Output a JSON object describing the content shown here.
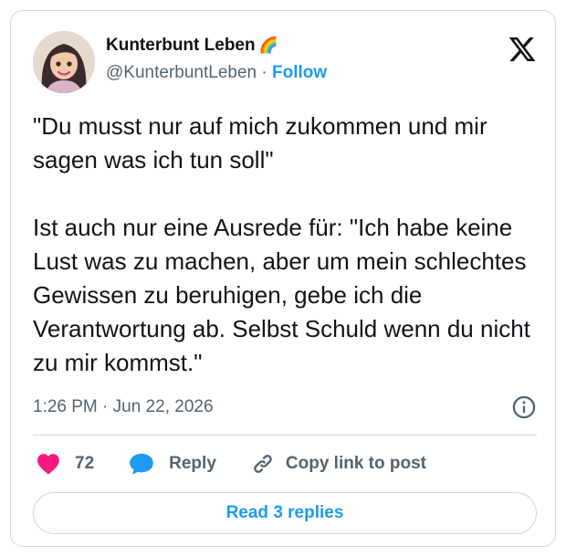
{
  "author": {
    "name": "Kunterbunt Leben",
    "name_emoji": "🌈",
    "handle": "@KunterbuntLeben",
    "separator": " · ",
    "follow_label": "Follow"
  },
  "tweet": {
    "text": "\"Du musst nur auf mich zukommen und mir sagen was ich tun soll\"\n\nIst auch nur eine Ausrede für: \"Ich habe keine Lust was zu machen, aber um mein schlechtes Gewissen zu beruhigen, gebe ich die Verantwortung ab. Selbst Schuld wenn du nicht zu mir kommst.\"",
    "timestamp": "1:26 PM · Jun 22, 2026"
  },
  "actions": {
    "like_count": "72",
    "reply_label": "Reply",
    "copy_label": "Copy link to post"
  },
  "read_replies_label": "Read 3 replies",
  "icons": {
    "brand": "x-logo-icon",
    "info": "info-icon",
    "like": "heart-icon",
    "reply": "speech-bubble-icon",
    "copy": "link-icon"
  },
  "colors": {
    "accent": "#1d9bf0",
    "like": "#f91880",
    "text": "#0f1419",
    "secondary": "#536471",
    "border": "#cfd9de"
  }
}
